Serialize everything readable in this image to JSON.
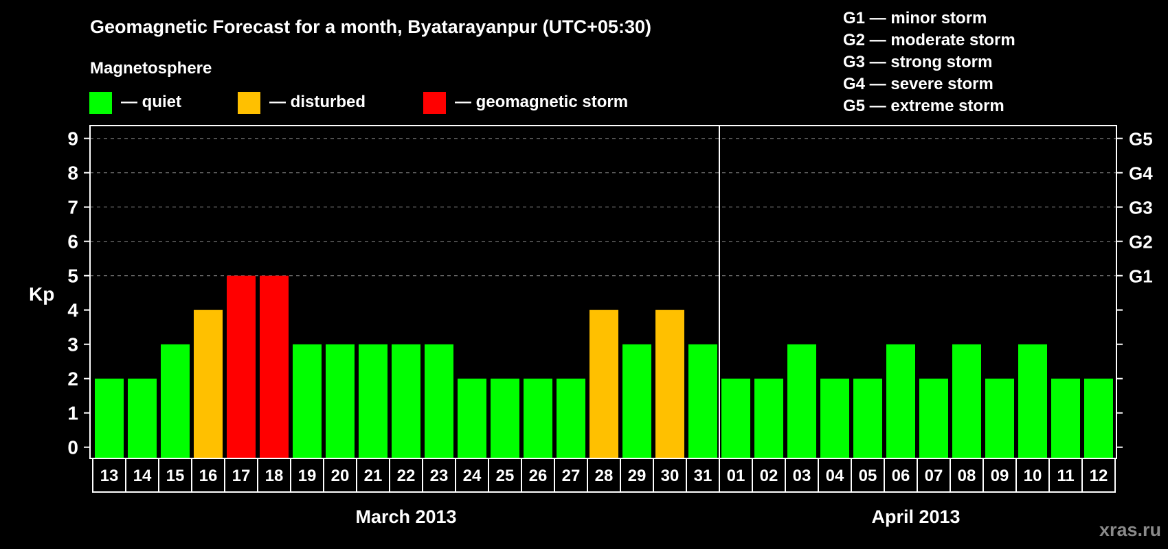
{
  "chart_data": {
    "type": "bar",
    "title": "Geomagnetic Forecast for a month, Byatarayanpur (UTC+05:30)",
    "subtitle": "Magnetosphere",
    "ylabel": "Kp",
    "ylim": [
      0,
      9
    ],
    "yticks": [
      "0",
      "1",
      "2",
      "3",
      "4",
      "5",
      "6",
      "7",
      "8",
      "9"
    ],
    "right_axis_labels": [
      {
        "kp": 5,
        "label": "G1"
      },
      {
        "kp": 6,
        "label": "G2"
      },
      {
        "kp": 7,
        "label": "G3"
      },
      {
        "kp": 8,
        "label": "G4"
      },
      {
        "kp": 9,
        "label": "G5"
      }
    ],
    "grid": "dashed horizontal at 5-9",
    "legend": [
      {
        "label": "— quiet",
        "color": "#00ff00"
      },
      {
        "label": "— disturbed",
        "color": "#ffc000"
      },
      {
        "label": "— geomagnetic storm",
        "color": "#ff0000"
      }
    ],
    "storm_scale": [
      "G1 — minor storm",
      "G2 — moderate storm",
      "G3 — strong storm",
      "G4 — severe storm",
      "G5 — extreme storm"
    ],
    "months": [
      "March 2013",
      "April 2013"
    ],
    "categories": [
      "13",
      "14",
      "15",
      "16",
      "17",
      "18",
      "19",
      "20",
      "21",
      "22",
      "23",
      "24",
      "25",
      "26",
      "27",
      "28",
      "29",
      "30",
      "31",
      "01",
      "02",
      "03",
      "04",
      "05",
      "06",
      "07",
      "08",
      "09",
      "10",
      "11",
      "12"
    ],
    "values": [
      2,
      2,
      3,
      4,
      5,
      5,
      3,
      3,
      3,
      3,
      3,
      2,
      2,
      2,
      2,
      4,
      3,
      4,
      3,
      2,
      2,
      3,
      2,
      2,
      3,
      2,
      3,
      2,
      3,
      2,
      2
    ],
    "level_colors": {
      "quiet": "#00ff00",
      "disturbed": "#ffc000",
      "storm": "#ff0000"
    }
  },
  "watermark": "xras.ru"
}
